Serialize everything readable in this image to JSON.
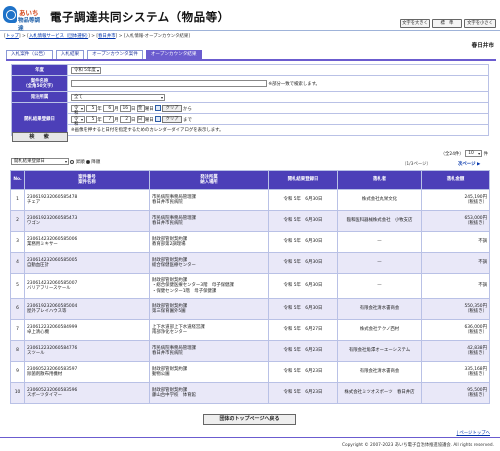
{
  "header": {
    "logo_line1": "あいち",
    "logo_line2": "物品等調達",
    "title": "電子調達共同システム（物品等）",
    "btn_large": "文字を大きく",
    "btn_std": "標　準",
    "btn_small": "文字を小さく"
  },
  "breadcrumb": {
    "items": [
      "トップ",
      "入札情報サービス（団体選択）",
      "春日井市"
    ],
    "current": "入札情報-オープンカウンタ結果",
    "sep": " > "
  },
  "city": "春日井市",
  "tabs": [
    "入札案件（公告）",
    "入札結果",
    "オープンカウンタ案件",
    "オープンカウンタ結果"
  ],
  "form": {
    "year_label": "年度",
    "year_value": "令和 5年度",
    "name_label": "案件名称",
    "name_sub": "（全角50文字）",
    "name_hint": "※部分一致で検索します。",
    "dept_label": "発注所属",
    "dept_value": "全て",
    "date_label": "開札結果登録日",
    "era": "令和",
    "from": {
      "y": "5",
      "m": "6",
      "d": "16",
      "wd": "金"
    },
    "to": {
      "y": "5",
      "m": "7",
      "d": "2",
      "wd": "日"
    },
    "u_year": "年",
    "u_month": "月",
    "u_day": "日",
    "u_wd": "曜日",
    "clear": "クリア",
    "from_word": "から",
    "to_word": "まで",
    "date_note": "※画像を押すると日付を指定するためのカレンダーダイアログを表示します。",
    "search": "検　索"
  },
  "list": {
    "sort_value": "開札結果登録日",
    "asc": "昇順",
    "desc": "降順",
    "count_prefix": "（全24件）",
    "per_page": "10",
    "per_page_unit": "件",
    "page_prev": "（1/3ページ）",
    "page_next": "次ページ",
    "columns": [
      "No.",
      "案件番号",
      "案件名称",
      "発注所属",
      "納入場所",
      "開札結果登録日",
      "落札者",
      "落札金額"
    ]
  },
  "rows": [
    {
      "no": "1",
      "num": "230619232060585478",
      "name": "チェア",
      "dept": "市民病院事務局管理課",
      "place": "春日井市民病院",
      "date": "令和 5年　6月30日",
      "winner": "株式会社丸栄文化",
      "amount": "245,190円",
      "tax": "（税抜き）"
    },
    {
      "no": "2",
      "num": "230619232060585473",
      "name": "ワゴン",
      "dept": "市民病院事務局管理課",
      "place": "春日井市民病院",
      "date": "令和 5年　6月30日",
      "winner": "臨和医科器械株式会社　小牧支店",
      "amount": "653,000円",
      "tax": "（税抜き）"
    },
    {
      "no": "3",
      "num": "230614232060585006",
      "name": "業務用ミキサー",
      "dept": "財政部管財契約課",
      "place": "教育部第2調理場",
      "date": "令和 5年　6月30日",
      "winner": "—",
      "amount": "不調",
      "tax": ""
    },
    {
      "no": "4",
      "num": "230614232060585005",
      "name": "自動血圧計",
      "dept": "財政部管財契約課",
      "place": "総合保健医療センター",
      "date": "令和 5年　6月30日",
      "winner": "—",
      "amount": "不調",
      "tax": ""
    },
    {
      "no": "5",
      "num": "230614232060585007",
      "name": "バリアフリースケール",
      "dept": "財政部管財契約課",
      "place": "・総合保健医療センター3階　母子保健課\n・保健センター1階　母子保健課",
      "date": "令和 5年　6月30日",
      "winner": "—",
      "amount": "不調",
      "tax": ""
    },
    {
      "no": "6",
      "num": "230619232060585004",
      "name": "屋外プレイハウス等",
      "dept": "財政部管財契約課",
      "place": "第三保育園外5園",
      "date": "令和 5年　6月30日",
      "winner": "有限会社清水書商会",
      "amount": "550,350円",
      "tax": "（税抜き）"
    },
    {
      "no": "7",
      "num": "230612232060584999",
      "name": "卓上清心機",
      "dept": "上下水道部上下水道経営課",
      "place": "南部浄化センター",
      "date": "令和 5年　6月27日",
      "winner": "株式会社テクノ西村",
      "amount": "636,000円",
      "tax": "（税抜き）"
    },
    {
      "no": "8",
      "num": "230612232060584776",
      "name": "スツール",
      "dept": "市民病院事務局管理課",
      "place": "春日井市民病院",
      "date": "令和 5年　6月23日",
      "winner": "有限会社角澤オーエーシステム",
      "amount": "42,838円",
      "tax": "（税抜き）"
    },
    {
      "no": "9",
      "num": "230605232060583597",
      "name": "除菌剤散布用機材",
      "dept": "財政部管財契約課",
      "place": "動物公園",
      "date": "令和 5年　6月23日",
      "winner": "有限会社清水書商会",
      "amount": "335,168円",
      "tax": "（税抜き）"
    },
    {
      "no": "10",
      "num": "230605232060583596",
      "name": "スポーツタイマー",
      "dept": "財政部管財契約課",
      "place": "藤山台中学校　体育館",
      "date": "令和 5年　6月23日",
      "winner": "株式会社ミツオスポーツ　春日井店",
      "amount": "95,500円",
      "tax": "（税抜き）"
    }
  ],
  "bottom": {
    "top_button": "団体のトップページへ戻る",
    "page_top": "ページトップへ",
    "copyright": "Copyright © 2007-2023 あいち電子自治体推進協議会. All rights reserved."
  },
  "colors": {
    "accent": "#4c3fb8",
    "tab_active": "#6b5ccf",
    "link": "#0033aa",
    "row_alt": "#e9e8f8"
  }
}
